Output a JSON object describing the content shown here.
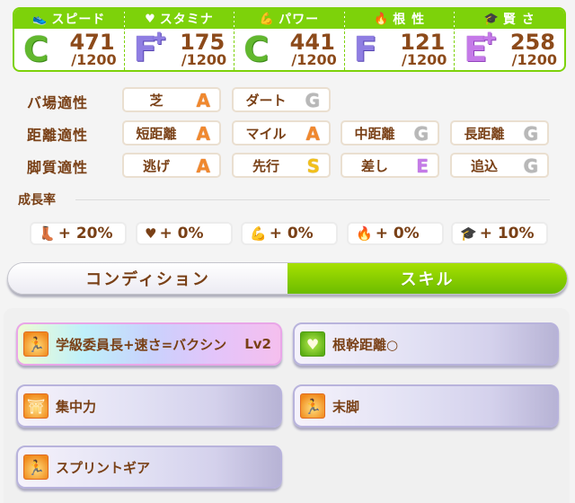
{
  "stats": [
    {
      "key": "speed",
      "icon": "shoe-icon",
      "glyph": "👟",
      "label": "スピード",
      "grade": "C",
      "plus": false,
      "value": "471",
      "max": "/1200"
    },
    {
      "key": "stamina",
      "icon": "heart-icon",
      "glyph": "♥",
      "label": "スタミナ",
      "grade": "F",
      "plus": true,
      "value": "175",
      "max": "/1200"
    },
    {
      "key": "power",
      "icon": "muscle-icon",
      "glyph": "💪",
      "label": "パワー",
      "grade": "C",
      "plus": false,
      "value": "441",
      "max": "/1200"
    },
    {
      "key": "guts",
      "icon": "flame-icon",
      "glyph": "🔥",
      "label": "根 性",
      "grade": "F",
      "plus": false,
      "value": "121",
      "max": "/1200"
    },
    {
      "key": "wit",
      "icon": "mortarboard-icon",
      "glyph": "🎓",
      "label": "賢 さ",
      "grade": "E",
      "plus": true,
      "value": "258",
      "max": "/1200"
    }
  ],
  "aptitudes": [
    {
      "label": "バ場適性",
      "items": [
        {
          "name": "芝",
          "rank": "A"
        },
        {
          "name": "ダート",
          "rank": "G"
        }
      ]
    },
    {
      "label": "距離適性",
      "items": [
        {
          "name": "短距離",
          "rank": "A"
        },
        {
          "name": "マイル",
          "rank": "A"
        },
        {
          "name": "中距離",
          "rank": "G"
        },
        {
          "name": "長距離",
          "rank": "G"
        }
      ]
    },
    {
      "label": "脚質適性",
      "items": [
        {
          "name": "逃げ",
          "rank": "A"
        },
        {
          "name": "先行",
          "rank": "S"
        },
        {
          "name": "差し",
          "rank": "E"
        },
        {
          "name": "追込",
          "rank": "G"
        }
      ]
    }
  ],
  "growth": {
    "title": "成長率",
    "items": [
      {
        "icon": "shoe-icon",
        "glyph": "👢",
        "value": "+ 20%"
      },
      {
        "icon": "heart-icon",
        "glyph": "♥",
        "value": "+ 0%"
      },
      {
        "icon": "muscle-icon",
        "glyph": "💪",
        "value": "+ 0%"
      },
      {
        "icon": "flame-icon",
        "glyph": "🔥",
        "value": "+ 0%"
      },
      {
        "icon": "mortarboard-icon",
        "glyph": "🎓",
        "value": "+ 10%"
      }
    ]
  },
  "tabs": [
    {
      "label": "コンディション",
      "active": false
    },
    {
      "label": "スキル",
      "active": true
    }
  ],
  "skills": [
    {
      "name": "学級委員長+速さ=バクシン",
      "level": "Lv2",
      "icon": "running-figure-icon",
      "glyph": "🏃",
      "style": "rainbow"
    },
    {
      "name": "根幹距離○",
      "level": "",
      "icon": "heart-icon",
      "glyph": "♥",
      "style": "green"
    },
    {
      "name": "集中力",
      "level": "",
      "icon": "starting-gate-icon",
      "glyph": "⛩",
      "style": "normal"
    },
    {
      "name": "末脚",
      "level": "",
      "icon": "running-figure-icon",
      "glyph": "🏃",
      "style": "normal"
    },
    {
      "name": "スプリントギア",
      "level": "",
      "icon": "running-figure-icon",
      "glyph": "🏃",
      "style": "normal"
    }
  ]
}
